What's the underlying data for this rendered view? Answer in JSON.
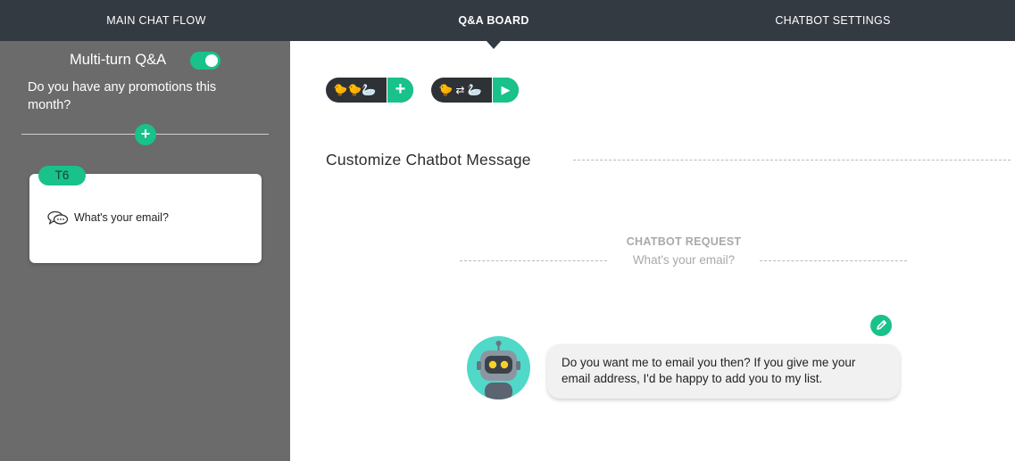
{
  "nav": {
    "tabs": [
      {
        "label": "MAIN CHAT FLOW"
      },
      {
        "label": "Q&A BOARD"
      },
      {
        "label": "CHATBOT SETTINGS"
      }
    ],
    "active_tab": "Q&A BOARD"
  },
  "sidebar": {
    "multiturn_label": "Multi-turn Q&A",
    "multiturn_enabled": true,
    "question": "Do you have any promotions this month?",
    "add_symbol": "+",
    "card": {
      "badge": "T6",
      "icon": "chat-bubbles-icon",
      "text": "What's your email?"
    }
  },
  "main": {
    "toolbar": {
      "buttons": [
        {
          "icon": "ducks-add-icon",
          "action_icon": "plus-icon",
          "action_symbol": "+"
        },
        {
          "icon": "ducks-sync-icon",
          "action_icon": "play-icon",
          "action_symbol": "▶"
        }
      ]
    },
    "section_title": "Customize Chatbot Message",
    "request": {
      "label": "CHATBOT REQUEST",
      "text": "What's your email?"
    },
    "bot_message": "Do you want me to email you then? If you give me your email address, I'd be happy to add you to my list.",
    "edit_icon": "pencil-icon"
  },
  "colors": {
    "accent": "#18c28a",
    "nav_bg": "#343a42",
    "sidebar_bg": "#6b6b6b",
    "avatar_bg": "#50d8c8"
  }
}
